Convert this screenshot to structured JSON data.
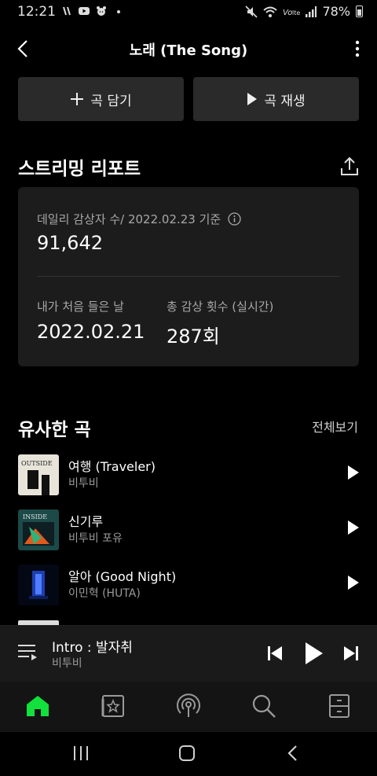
{
  "status_bar": {
    "time": "12:21",
    "battery": "78%",
    "icons": [
      "notification-icon",
      "youtube-icon",
      "bear-app-icon",
      "dot-icon",
      "mute-icon",
      "wifi-icon",
      "volte-icon",
      "signal-icon",
      "battery-icon"
    ]
  },
  "header": {
    "title": "노래 (The Song)"
  },
  "actions": {
    "add_label": "곡 담기",
    "play_label": "곡 재생"
  },
  "report": {
    "section_title": "스트리밍 리포트",
    "daily_label": "데일리 감상자 수/ 2022.02.23 기준",
    "daily_value": "91,642",
    "first_listen_label": "내가 처음 들은 날",
    "first_listen_value": "2022.02.21",
    "total_plays_label": "총 감상 횟수 (실시간)",
    "total_plays_value": "287회"
  },
  "similar": {
    "section_title": "유사한 곡",
    "see_all": "전체보기",
    "songs": [
      {
        "title": "여행 (Traveler)",
        "artist": "비투비"
      },
      {
        "title": "신기루",
        "artist": "비투비 포유"
      },
      {
        "title": "알아 (Good Night)",
        "artist": "이민혁 (HUTA)"
      }
    ]
  },
  "album_text": {
    "outside": "OUTSIDE",
    "inside": "INSIDE"
  },
  "now_playing": {
    "title": "Intro : 발자취",
    "artist": "비투비"
  },
  "colors": {
    "accent": "#12e03c",
    "background": "#000000",
    "card": "#1c1c1c",
    "button": "#2a2a2a"
  },
  "tabs": [
    "home-icon",
    "library-icon",
    "podcast-icon",
    "search-icon",
    "menu-icon"
  ]
}
